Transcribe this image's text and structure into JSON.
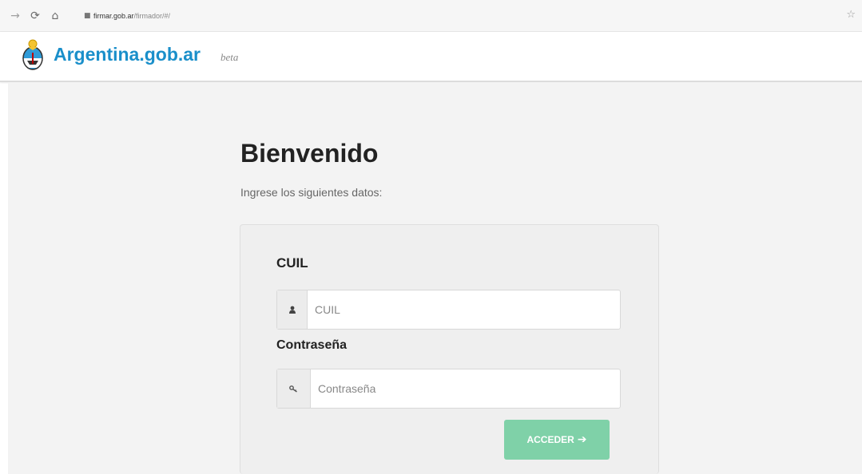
{
  "browser": {
    "back_icon": "arrow-right-icon",
    "reload_icon": "reload-icon",
    "home_icon": "home-icon",
    "lock_icon": "lock-icon",
    "url_host": "firmar.gob.ar",
    "url_path": "/firmador/#/",
    "bookmark_icon": "star-icon"
  },
  "header": {
    "logo_icon": "coat-of-arms-icon",
    "site_name": "Argentina.gob.ar",
    "badge": "beta",
    "brand_color": "#1a8fca"
  },
  "main": {
    "title": "Bienvenido",
    "subtitle": "Ingrese los siguientes datos:"
  },
  "form": {
    "cuil_label": "CUIL",
    "cuil_placeholder": "CUIL",
    "cuil_icon": "user-icon",
    "password_label": "Contraseña",
    "password_placeholder": "Contraseña",
    "password_icon": "key-icon",
    "submit_label": "ACCEDER",
    "submit_icon": "arrow-right-icon",
    "submit_color": "#7fd1a8"
  }
}
